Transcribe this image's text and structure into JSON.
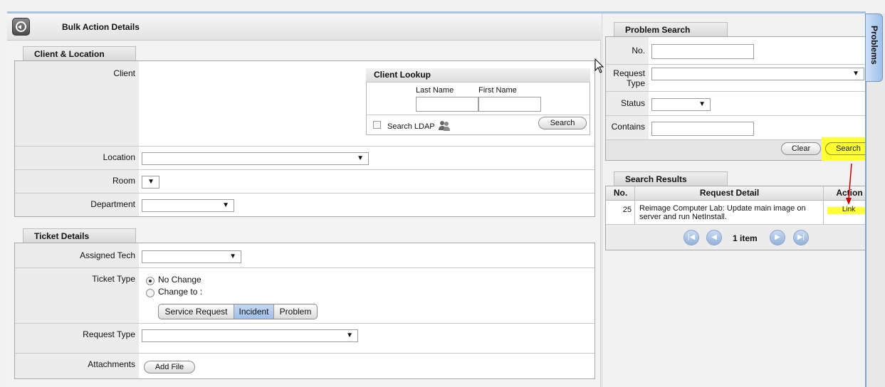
{
  "header": {
    "title": "Bulk Action Details"
  },
  "client_location": {
    "tab": "Client & Location",
    "client_label": "Client",
    "lookup": {
      "title": "Client Lookup",
      "last_name_label": "Last Name",
      "first_name_label": "First Name",
      "last_name_value": "",
      "first_name_value": "",
      "search_ldap_label": "Search LDAP",
      "search_button": "Search"
    },
    "location_label": "Location",
    "room_label": "Room",
    "department_label": "Department"
  },
  "ticket_details": {
    "tab": "Ticket Details",
    "assigned_tech_label": "Assigned Tech",
    "ticket_type_label": "Ticket Type",
    "no_change_label": "No Change",
    "change_to_label": "Change to :",
    "types": [
      "Service Request",
      "Incident",
      "Problem"
    ],
    "active_type": "Incident",
    "request_type_label": "Request Type",
    "attachments_label": "Attachments",
    "add_file_button": "Add File"
  },
  "problem_search": {
    "tab": "Problem Search",
    "no_label": "No.",
    "request_type_label": "Request Type",
    "status_label": "Status",
    "contains_label": "Contains",
    "clear_button": "Clear",
    "search_button": "Search"
  },
  "search_results": {
    "tab": "Search Results",
    "columns": [
      "No.",
      "Request Detail",
      "Action"
    ],
    "rows": [
      {
        "no": "25",
        "detail": "Reimage Computer Lab: Update main image on server and run NetInstall.",
        "action": "Link"
      }
    ],
    "pager_text": "1 item"
  },
  "side_tab": {
    "label": "Problems"
  },
  "colors": {
    "highlight": "#ffff33",
    "annotation_arrow": "#cc0000",
    "accent": "#9ec0ea"
  },
  "arrow_glyph": "▼"
}
